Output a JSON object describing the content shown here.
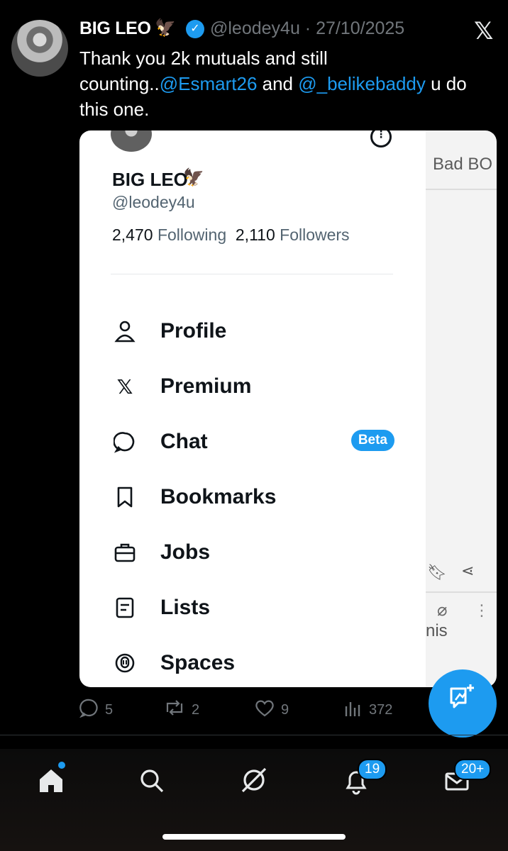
{
  "tweet": {
    "author_name": "BIG LEO",
    "author_emoji": "🦅",
    "handle_time": "@leodey4u · 27/10/2025",
    "text_parts": {
      "t1": "Thank you 2k mutuals and still counting..",
      "m1": "@Esmart26",
      "t2": " and ",
      "m2": "@_belikebaddy",
      "t3": " u do this one."
    }
  },
  "screenshot": {
    "drawer": {
      "name": "BIG LEO",
      "emoji": "🦅",
      "handle": "@leodey4u",
      "following_count": "2,470",
      "following_label": "Following",
      "followers_count": "2,110",
      "followers_label": "Followers",
      "menu": [
        {
          "label": "Profile",
          "icon": "person-icon"
        },
        {
          "label": "Premium",
          "icon": "x-logo-icon"
        },
        {
          "label": "Chat",
          "icon": "chat-bubble-icon",
          "badge": "Beta"
        },
        {
          "label": "Bookmarks",
          "icon": "bookmark-icon"
        },
        {
          "label": "Jobs",
          "icon": "briefcase-icon"
        },
        {
          "label": "Lists",
          "icon": "list-icon"
        },
        {
          "label": "Spaces",
          "icon": "spaces-mic-icon"
        }
      ]
    },
    "background": {
      "badbo_text": "Bad BO",
      "nis_text": "nis"
    }
  },
  "actions": {
    "replies": "5",
    "reposts": "2",
    "likes": "9",
    "views": "372"
  },
  "nav": {
    "notifications_badge": "19",
    "messages_badge": "20+"
  },
  "colors": {
    "accent": "#1d9bf0",
    "background": "#000000",
    "muted": "#71767b"
  }
}
